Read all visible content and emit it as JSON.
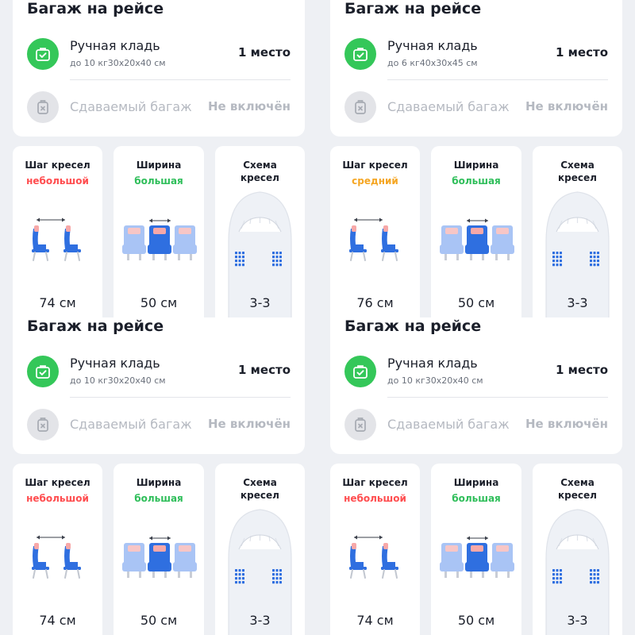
{
  "panels": [
    {
      "baggage": {
        "title": "Багаж на рейсе",
        "carry_on": {
          "label": "Ручная кладь",
          "detail": "до 10 кг30х20х40 см",
          "value": "1 место",
          "icon": "suitcase-check-icon"
        },
        "checked": {
          "label": "Сдаваемый багаж",
          "value": "Не включён",
          "icon": "suitcase-cross-icon"
        }
      },
      "seat_pitch": {
        "title": "Шаг кресел",
        "quality": "небольшой",
        "quality_color": "#ff4d4f",
        "value": "74 см"
      },
      "seat_width": {
        "title": "Ширина",
        "quality": "большая",
        "quality_color": "#2fbe5a",
        "value": "50 см"
      },
      "layout": {
        "title_line1": "Схема",
        "title_line2": "кресел",
        "value": "3-3"
      }
    },
    {
      "baggage": {
        "title": "Багаж на рейсе",
        "carry_on": {
          "label": "Ручная кладь",
          "detail": "до 6 кг40х30х45 см",
          "value": "1 место",
          "icon": "suitcase-check-icon"
        },
        "checked": {
          "label": "Сдаваемый багаж",
          "value": "Не включён",
          "icon": "suitcase-cross-icon"
        }
      },
      "seat_pitch": {
        "title": "Шаг кресел",
        "quality": "средний",
        "quality_color": "#f5a623",
        "value": "76 см"
      },
      "seat_width": {
        "title": "Ширина",
        "quality": "большая",
        "quality_color": "#2fbe5a",
        "value": "50 см"
      },
      "layout": {
        "title_line1": "Схема",
        "title_line2": "кресел",
        "value": "3-3"
      }
    },
    {
      "baggage": {
        "title": "Багаж на рейсе",
        "carry_on": {
          "label": "Ручная кладь",
          "detail": "до 10 кг30х20х40 см",
          "value": "1 место",
          "icon": "suitcase-check-icon"
        },
        "checked": {
          "label": "Сдаваемый багаж",
          "value": "Не включён",
          "icon": "suitcase-cross-icon"
        }
      },
      "seat_pitch": {
        "title": "Шаг кресел",
        "quality": "небольшой",
        "quality_color": "#ff4d4f",
        "value": "74 см"
      },
      "seat_width": {
        "title": "Ширина",
        "quality": "большая",
        "quality_color": "#2fbe5a",
        "value": "50 см"
      },
      "layout": {
        "title_line1": "Схема",
        "title_line2": "кресел",
        "value": "3-3"
      }
    },
    {
      "baggage": {
        "title": "Багаж на рейсе",
        "carry_on": {
          "label": "Ручная кладь",
          "detail": "до 10 кг30х20х40 см",
          "value": "1 место",
          "icon": "suitcase-check-icon"
        },
        "checked": {
          "label": "Сдаваемый багаж",
          "value": "Не включён",
          "icon": "suitcase-cross-icon"
        }
      },
      "seat_pitch": {
        "title": "Шаг кресел",
        "quality": "небольшой",
        "quality_color": "#ff4d4f",
        "value": "74 см"
      },
      "seat_width": {
        "title": "Ширина",
        "quality": "большая",
        "quality_color": "#2fbe5a",
        "value": "50 см"
      },
      "layout": {
        "title_line1": "Схема",
        "title_line2": "кресел",
        "value": "3-3"
      }
    }
  ],
  "colors": {
    "accent_green": "#34c759",
    "seat_blue": "#2f6fe0",
    "seat_light": "#a9c4f5",
    "seat_pink": "#f7a8a8",
    "muted_gray": "#b5b9c1"
  }
}
